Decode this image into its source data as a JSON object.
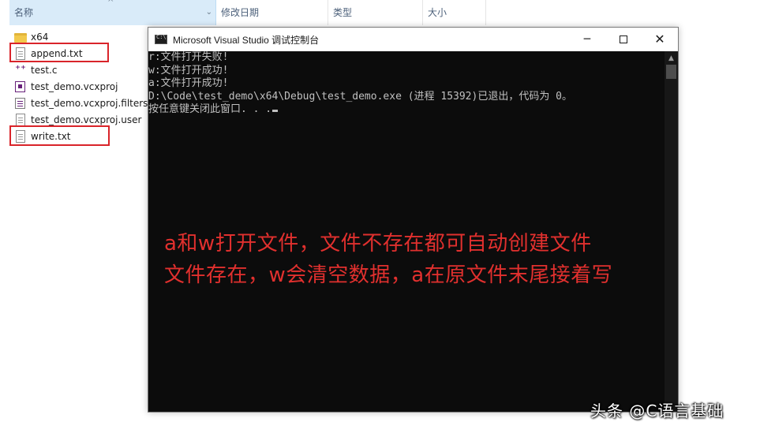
{
  "explorer": {
    "columns": {
      "name": "名称",
      "date": "修改日期",
      "type": "类型",
      "size": "大小"
    },
    "files": [
      {
        "name": "x64",
        "icon": "folder-icon"
      },
      {
        "name": "append.txt",
        "icon": "text-file-icon"
      },
      {
        "name": "test.c",
        "icon": "c-source-icon"
      },
      {
        "name": "test_demo.vcxproj",
        "icon": "vcxproj-icon"
      },
      {
        "name": "test_demo.vcxproj.filters",
        "icon": "filters-file-icon"
      },
      {
        "name": "test_demo.vcxproj.user",
        "icon": "user-file-icon"
      },
      {
        "name": "write.txt",
        "icon": "text-file-icon"
      }
    ],
    "highlight_color": "#d9242a"
  },
  "console": {
    "title": "Microsoft Visual Studio 调试控制台",
    "lines": [
      "r:文件打开失败!",
      "w:文件打开成功!",
      "a:文件打开成功!",
      "",
      "D:\\Code\\test_demo\\x64\\Debug\\test_demo.exe (进程 15392)已退出，代码为 0。",
      "按任意键关闭此窗口. . ."
    ],
    "buttons": {
      "minimize": "─",
      "close": "✕"
    },
    "annotation": [
      "a和w打开文件，文件不存在都可自动创建文件",
      "文件存在，w会清空数据，a在原文件末尾接着写"
    ],
    "annotation_color": "#e1302e"
  },
  "watermark": "头条 @C语言基础"
}
